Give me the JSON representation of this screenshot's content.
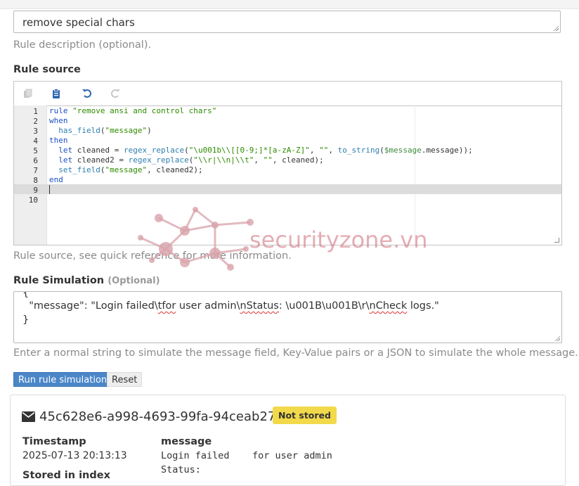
{
  "description": {
    "value": "remove special chars",
    "help": "Rule description (optional)."
  },
  "rule_source": {
    "label": "Rule source",
    "help": "Rule source, see quick reference for more information.",
    "toolbar": [
      "copy-icon",
      "paste-icon",
      "undo-icon",
      "redo-icon"
    ],
    "line_numbers": [
      "1",
      "2",
      "3",
      "4",
      "5",
      "6",
      "7",
      "8",
      "9",
      "10"
    ],
    "code": [
      "rule \"remove ansi and control chars\"",
      "when",
      "  has_field(\"message\")",
      "then",
      "  let cleaned = regex_replace(\"\\u001b\\\\[[0-9;]*[a-zA-Z]\", \"\", to_string($message.message));",
      "  let cleaned2 = regex_replace(\"\\\\r|\\\\n|\\\\t\", \"\", cleaned);",
      "  set_field(\"message\", cleaned2);",
      "end",
      "",
      ""
    ],
    "active_line": 9
  },
  "simulation": {
    "label": "Rule Simulation",
    "optional": "(Optional)",
    "lines": [
      "{",
      "  \"message\": \"Login failed\\tfor user admin\\nStatus: \\u001B\\u001B\\r\\nCheck logs.\"",
      "}"
    ],
    "help": "Enter a normal string to simulate the message field, Key-Value pairs or a JSON to simulate the whole message.",
    "run_label": "Run rule simulation",
    "reset_label": "Reset"
  },
  "result": {
    "message_id": "45c628e6-a998-4693-99fa-94ceab27245f",
    "badge": "Not stored",
    "timestamp_label": "Timestamp",
    "timestamp_value": "2025-07-13 20:13:13",
    "stored_label": "Stored in index",
    "message_label": "message",
    "message_line1": "Login failed    for user admin",
    "message_line2": "Status:"
  },
  "watermark": "securityzone.vn",
  "colors": {
    "primary_button": "#4a86c8",
    "badge": "#f2d94a",
    "keyword": "#1a4fc4",
    "string": "#2e8b00",
    "watermark": "#cf6b78"
  }
}
